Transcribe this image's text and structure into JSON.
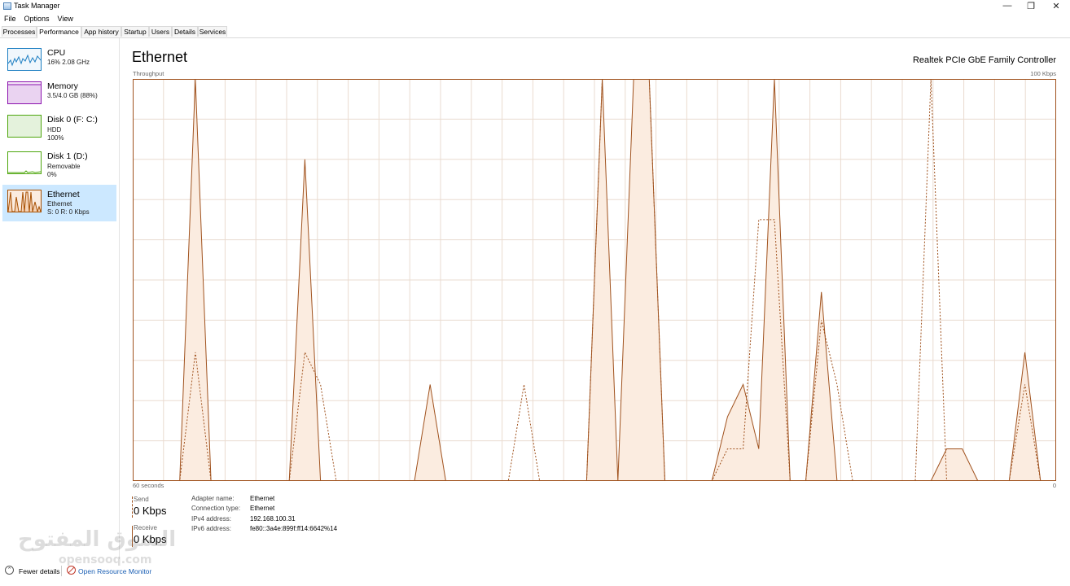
{
  "window": {
    "title": "Task Manager",
    "minimize": "—",
    "restore": "❐",
    "close": "✕"
  },
  "menu": [
    "File",
    "Options",
    "View"
  ],
  "tabs": [
    "Processes",
    "Performance",
    "App history",
    "Startup",
    "Users",
    "Details",
    "Services"
  ],
  "active_tab": "Performance",
  "sidebar": [
    {
      "name": "CPU",
      "line1": "16% 2.08 GHz",
      "line2": "",
      "line3": "",
      "color": "#1c7ec2"
    },
    {
      "name": "Memory",
      "line1": "3.5/4.0 GB (88%)",
      "line2": "",
      "line3": "",
      "color": "#8b12ae"
    },
    {
      "name": "Disk 0 (F: C:)",
      "line1": "HDD",
      "line2": "100%",
      "line3": "",
      "color": "#4da60c"
    },
    {
      "name": "Disk 1 (D:)",
      "line1": "Removable",
      "line2": "0%",
      "line3": "",
      "color": "#4da60c"
    },
    {
      "name": "Ethernet",
      "line1": "Ethernet",
      "line2": "S: 0 R: 0 Kbps",
      "line3": "",
      "color": "#a74f01"
    }
  ],
  "main": {
    "title": "Ethernet",
    "adapter": "Realtek PCIe GbE Family Controller",
    "axis_top_left": "Throughput",
    "axis_top_right": "100 Kbps",
    "axis_bottom_left": "60 seconds",
    "axis_bottom_right": "0"
  },
  "stats": {
    "send_label": "Send",
    "send_value": "0 Kbps",
    "receive_label": "Receive",
    "receive_value": "0 Kbps"
  },
  "info": [
    {
      "key": "Adapter name:",
      "value": "Ethernet"
    },
    {
      "key": "Connection type:",
      "value": "Ethernet"
    },
    {
      "key": "IPv4 address:",
      "value": "192.168.100.31"
    },
    {
      "key": "IPv6 address:",
      "value": "fe80::3a4e:899f:ff14:6642%14"
    }
  ],
  "footer": {
    "fewer_details": "Fewer details",
    "open_resource_monitor": "Open Resource Monitor"
  },
  "watermark": {
    "text": "السوق المفتوح",
    "sub": "opensooq.com"
  },
  "chart_data": {
    "type": "area",
    "xlabel": "",
    "ylabel": "Throughput",
    "ylim": [
      0,
      100
    ],
    "x_range_seconds": [
      60,
      0
    ],
    "series": [
      {
        "name": "Receive",
        "style": "solid",
        "values": [
          0,
          0,
          0,
          0,
          100,
          0,
          0,
          0,
          0,
          0,
          0,
          80,
          0,
          0,
          0,
          0,
          0,
          0,
          0,
          24,
          0,
          0,
          0,
          0,
          0,
          0,
          0,
          0,
          0,
          0,
          100,
          0,
          100,
          100,
          0,
          0,
          0,
          0,
          16,
          24,
          8,
          100,
          0,
          0,
          47,
          0,
          0,
          0,
          0,
          0,
          0,
          0,
          8,
          8,
          0,
          0,
          0,
          32,
          0,
          0
        ]
      },
      {
        "name": "Send",
        "style": "dashed",
        "values": [
          0,
          0,
          0,
          0,
          32,
          0,
          0,
          0,
          0,
          0,
          0,
          32,
          24,
          0,
          0,
          0,
          0,
          0,
          0,
          0,
          0,
          0,
          0,
          0,
          0,
          24,
          0,
          0,
          0,
          0,
          100,
          100,
          100,
          100,
          0,
          0,
          0,
          0,
          8,
          8,
          65,
          65,
          0,
          0,
          40,
          24,
          0,
          0,
          0,
          0,
          0,
          100,
          0,
          0,
          0,
          0,
          0,
          24,
          0,
          0
        ]
      }
    ],
    "grid": true,
    "colors": {
      "line": "#a0521e",
      "fill": "#fbece0",
      "grid": "#eadbd0"
    }
  }
}
